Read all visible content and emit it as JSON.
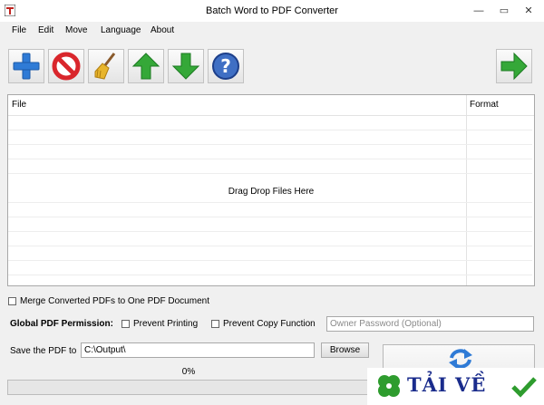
{
  "window": {
    "title": "Batch Word to PDF Converter",
    "controls": {
      "minimize": "—",
      "maximize": "▭",
      "close": "✕"
    }
  },
  "menu": [
    "File",
    "Edit",
    "Move",
    "Language",
    "About"
  ],
  "toolbar": {
    "buttons": [
      "add-files-icon",
      "remove-icon",
      "clear-list-broom-icon",
      "move-up-arrow-icon",
      "move-down-arrow-icon",
      "help-icon",
      "convert-arrow-icon"
    ]
  },
  "file_list": {
    "columns": {
      "file": "File",
      "format": "Format"
    },
    "drop_hint": "Drag  Drop Files Here"
  },
  "options": {
    "merge_label": "Merge Converted PDFs to One PDF Document",
    "merge_checked": false,
    "permission_label": "Global PDF Permission:",
    "prevent_printing": "Prevent Printing",
    "prevent_copy": "Prevent Copy Function",
    "owner_password_placeholder": "Owner Password (Optional)"
  },
  "output": {
    "save_label": "Save the PDF to",
    "save_path": "C:\\Output\\",
    "browse_label": "Browse"
  },
  "progress": {
    "percent_text": "0%",
    "value": 0
  },
  "watermark": {
    "text": "TẢI VỀ"
  },
  "colors": {
    "accent_blue": "#2f7bd6",
    "arrow_green": "#35a838",
    "stop_red": "#d9262c",
    "progress_green": "#06b025",
    "watermark_blue": "#1a2c8c"
  }
}
